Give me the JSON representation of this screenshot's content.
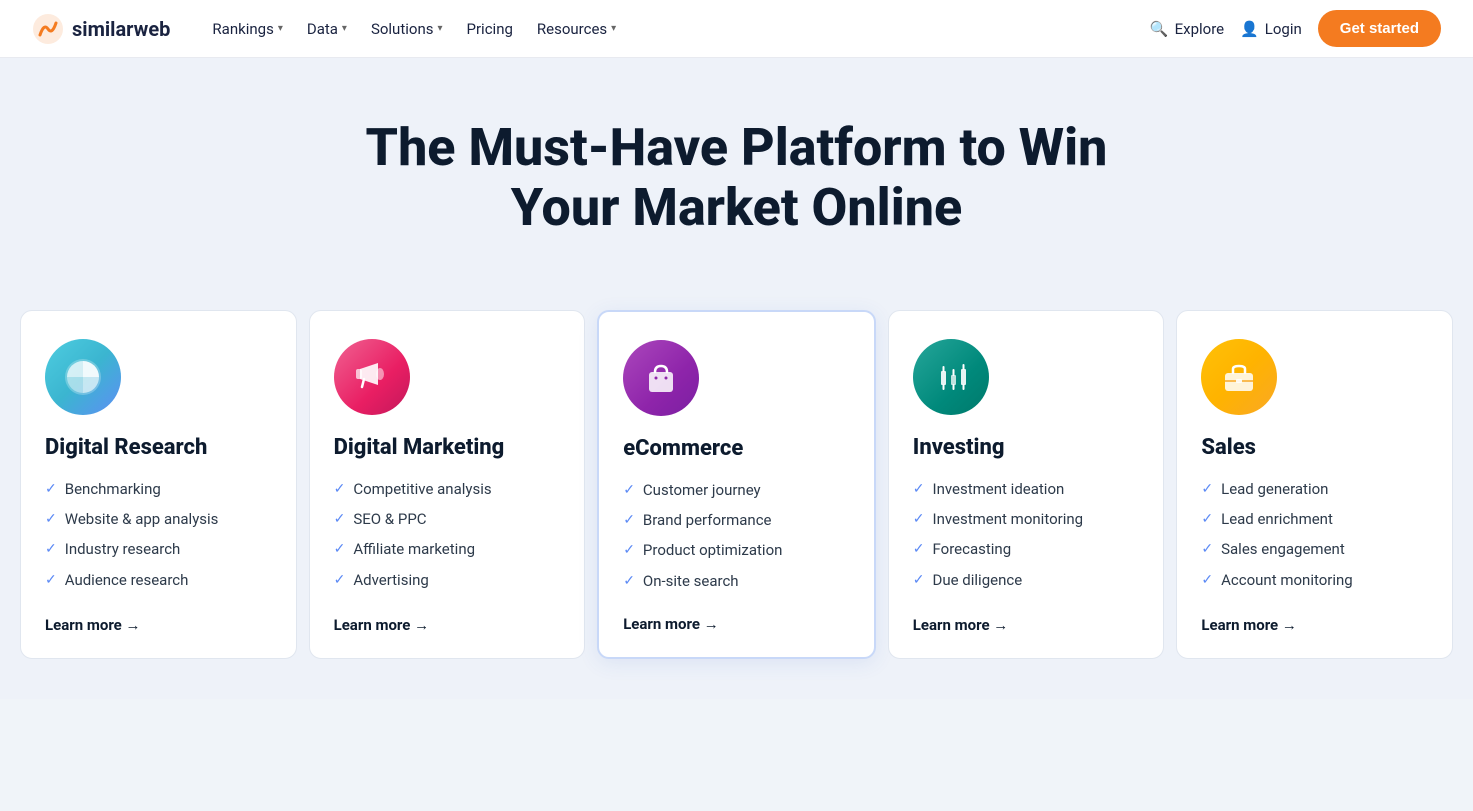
{
  "nav": {
    "logo_text": "similarweb",
    "items": [
      {
        "label": "Rankings",
        "has_dropdown": true
      },
      {
        "label": "Data",
        "has_dropdown": true
      },
      {
        "label": "Solutions",
        "has_dropdown": true
      },
      {
        "label": "Pricing",
        "has_dropdown": false
      },
      {
        "label": "Resources",
        "has_dropdown": true
      }
    ],
    "explore_label": "Explore",
    "login_label": "Login",
    "cta_label": "Get started"
  },
  "hero": {
    "title": "The Must-Have Platform to Win Your Market Online"
  },
  "cards": [
    {
      "id": "digital-research",
      "icon_label": "pie-chart-icon",
      "icon_class": "icon-research",
      "title": "Digital Research",
      "items": [
        "Benchmarking",
        "Website & app analysis",
        "Industry research",
        "Audience research"
      ],
      "learn_more": "Learn more →",
      "highlighted": false
    },
    {
      "id": "digital-marketing",
      "icon_label": "megaphone-icon",
      "icon_class": "icon-marketing",
      "title": "Digital Marketing",
      "items": [
        "Competitive analysis",
        "SEO & PPC",
        "Affiliate marketing",
        "Advertising"
      ],
      "learn_more": "Learn more →",
      "highlighted": false
    },
    {
      "id": "ecommerce",
      "icon_label": "shopping-bag-icon",
      "icon_class": "icon-ecommerce",
      "title": "eCommerce",
      "items": [
        "Customer journey",
        "Brand performance",
        "Product optimization",
        "On-site search"
      ],
      "learn_more": "Learn more →",
      "highlighted": true
    },
    {
      "id": "investing",
      "icon_label": "candlestick-chart-icon",
      "icon_class": "icon-investing",
      "title": "Investing",
      "items": [
        "Investment ideation",
        "Investment monitoring",
        "Forecasting",
        "Due diligence"
      ],
      "learn_more": "Learn more →",
      "highlighted": false
    },
    {
      "id": "sales",
      "icon_label": "briefcase-icon",
      "icon_class": "icon-sales",
      "title": "Sales",
      "items": [
        "Lead generation",
        "Lead enrichment",
        "Sales engagement",
        "Account monitoring"
      ],
      "learn_more": "Learn more →",
      "highlighted": false
    }
  ]
}
